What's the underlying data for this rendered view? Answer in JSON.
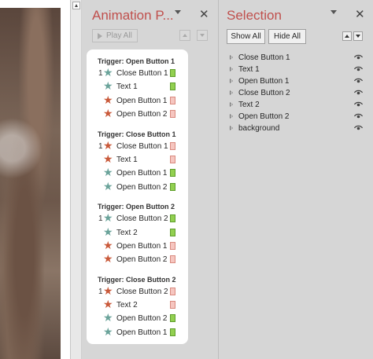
{
  "animation_pane": {
    "title": "Animation P...",
    "play_all": "Play All",
    "groups": [
      {
        "trigger": "Trigger: Open Button 1",
        "items": [
          {
            "order": "1",
            "effect": "entrance",
            "name": "Close Button 1",
            "bar": "entrance"
          },
          {
            "order": "",
            "effect": "entrance",
            "name": "Text 1",
            "bar": "entrance"
          },
          {
            "order": "",
            "effect": "exit",
            "name": "Open Button 1",
            "bar": "exit"
          },
          {
            "order": "",
            "effect": "exit",
            "name": "Open Button 2",
            "bar": "exit"
          }
        ]
      },
      {
        "trigger": "Trigger: Close Button 1",
        "items": [
          {
            "order": "1",
            "effect": "exit",
            "name": "Close Button 1",
            "bar": "exit"
          },
          {
            "order": "",
            "effect": "exit",
            "name": "Text 1",
            "bar": "exit"
          },
          {
            "order": "",
            "effect": "entrance",
            "name": "Open Button 1",
            "bar": "entrance"
          },
          {
            "order": "",
            "effect": "entrance",
            "name": "Open Button 2",
            "bar": "entrance"
          }
        ]
      },
      {
        "trigger": "Trigger: Open Button 2",
        "items": [
          {
            "order": "1",
            "effect": "entrance",
            "name": "Close Button 2",
            "bar": "entrance"
          },
          {
            "order": "",
            "effect": "entrance",
            "name": "Text 2",
            "bar": "entrance"
          },
          {
            "order": "",
            "effect": "exit",
            "name": "Open Button 1",
            "bar": "exit"
          },
          {
            "order": "",
            "effect": "exit",
            "name": "Open Button 2",
            "bar": "exit"
          }
        ]
      },
      {
        "trigger": "Trigger: Close Button 2",
        "items": [
          {
            "order": "1",
            "effect": "exit",
            "name": "Close Button 2",
            "bar": "exit"
          },
          {
            "order": "",
            "effect": "exit",
            "name": "Text 2",
            "bar": "exit"
          },
          {
            "order": "",
            "effect": "entrance",
            "name": "Open Button 2",
            "bar": "entrance"
          },
          {
            "order": "",
            "effect": "entrance",
            "name": "Open Button 1",
            "bar": "entrance"
          }
        ]
      }
    ]
  },
  "selection_pane": {
    "title": "Selection",
    "show_all": "Show All",
    "hide_all": "Hide All",
    "items": [
      "Close Button 1",
      "Text 1",
      "Open Button 1",
      "Close Button 2",
      "Text 2",
      "Open Button 2",
      "background"
    ]
  },
  "icons": {
    "star_glyph": "★",
    "close_glyph": "✕",
    "visibility": "eye-icon"
  },
  "colors": {
    "pane_title": "#c0504d",
    "entrance_star": "#6aa39a",
    "exit_star": "#c9593a",
    "entrance_bar": "#92d050",
    "exit_bar": "#f6c6c0"
  }
}
